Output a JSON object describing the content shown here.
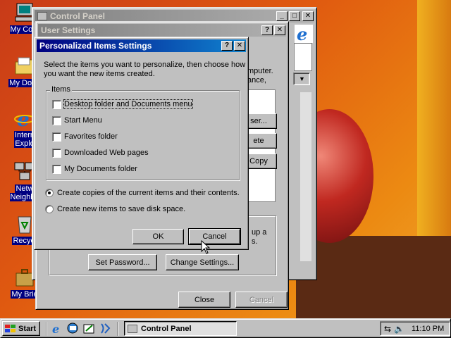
{
  "desktop": {
    "icons": [
      {
        "label": "My Com"
      },
      {
        "label": "My Docu"
      },
      {
        "label_line1": "Intern",
        "label_line2": "Explo"
      },
      {
        "label_line1": "Netw",
        "label_line2": "Neighbo"
      },
      {
        "label": "Recycl"
      },
      {
        "label": "My Brie"
      }
    ]
  },
  "control_panel": {
    "title": "Control Panel"
  },
  "user_settings": {
    "title": "User Settings",
    "partial_text_1": "mputer.",
    "partial_text_2": "ance,",
    "partial_user_btn": "ser...",
    "partial_delete_btn": "ete",
    "copy_button": "Copy",
    "partial_setup_1": "up a",
    "partial_setup_2": "s.",
    "set_password_button": "Set Password...",
    "change_settings_button": "Change Settings...",
    "close_button": "Close",
    "cancel_button": "Cancel"
  },
  "dialog": {
    "title": "Personalized Items Settings",
    "instructions_line1": "Select the items you want to personalize, then choose how",
    "instructions_line2": "you want the new items created.",
    "group_label": "Items",
    "items": [
      {
        "label": "Desktop folder and Documents menu",
        "checked": false
      },
      {
        "label": "Start Menu",
        "checked": false
      },
      {
        "label": "Favorites folder",
        "checked": false
      },
      {
        "label": "Downloaded Web pages",
        "checked": false
      },
      {
        "label": "My Documents folder",
        "checked": false
      }
    ],
    "options": [
      {
        "label": "Create copies of the current items and their contents.",
        "selected": true
      },
      {
        "label": "Create new items to save disk space.",
        "selected": false
      }
    ],
    "ok_button": "OK",
    "cancel_button": "Cancel"
  },
  "taskbar": {
    "start_label": "Start",
    "task_button": "Control Panel",
    "clock": "11:10 PM"
  }
}
